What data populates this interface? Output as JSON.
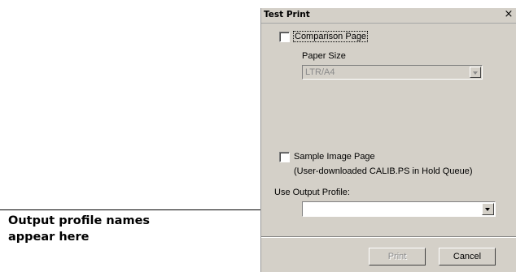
{
  "annotation": {
    "text": "Output profile names appear here"
  },
  "dialog": {
    "title": "Test Print",
    "close_glyph": "×",
    "comparison_page": {
      "label": "Comparison Page",
      "checked": false
    },
    "paper_size": {
      "label": "Paper Size",
      "value": "LTR/A4",
      "enabled": false
    },
    "sample_image_page": {
      "label": "Sample Image Page",
      "note": "(User-downloaded CALIB.PS in Hold Queue)",
      "checked": false
    },
    "output_profile": {
      "label": "Use Output Profile:",
      "value": ""
    },
    "buttons": {
      "print": "Print",
      "cancel": "Cancel"
    }
  }
}
